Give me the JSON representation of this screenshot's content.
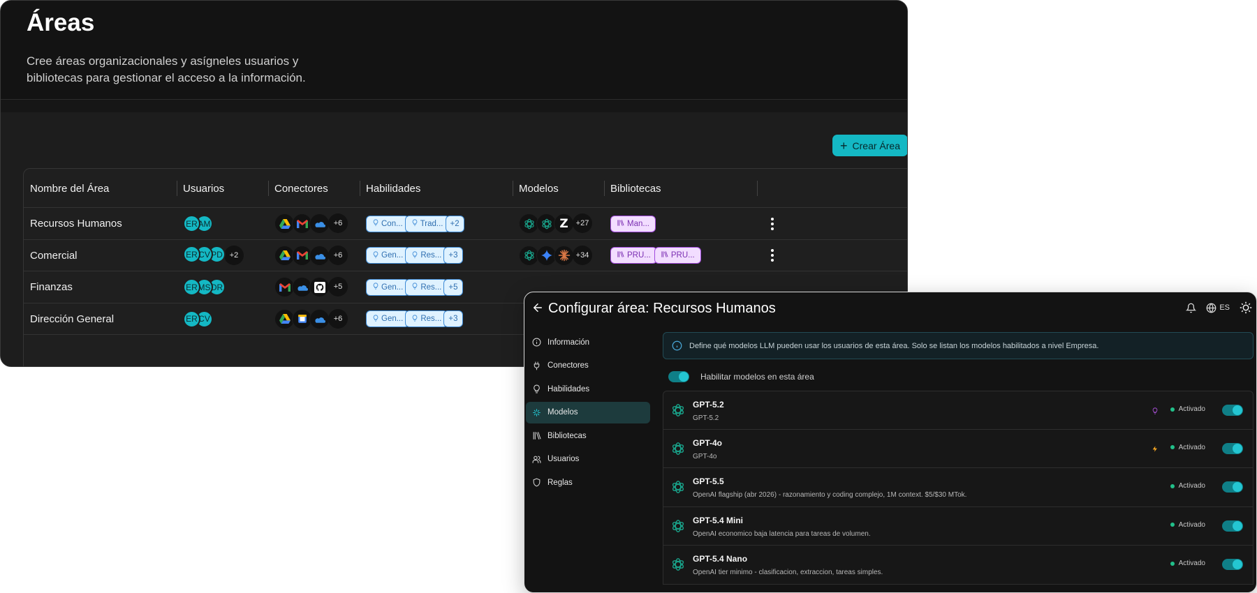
{
  "areas": {
    "title": "Áreas",
    "subtitle": "Cree áreas organizacionales y asígneles usuarios y bibliotecas para gestionar el acceso a la información.",
    "create_button": "Crear Área",
    "columns": [
      "Nombre del Área",
      "Usuarios",
      "Conectores",
      "Habilidades",
      "Modelos",
      "Bibliotecas"
    ],
    "rows": [
      {
        "name": "Recursos Humanos",
        "users": [
          "ER",
          "AM"
        ],
        "users_more": "",
        "connectors": [
          "google-drive",
          "gmail",
          "onedrive"
        ],
        "connectors_more": "+6",
        "skills": [
          "Con...",
          "Trad..."
        ],
        "skills_more": "+2",
        "models": [
          "openai",
          "openai",
          "zapier"
        ],
        "models_more": "+27",
        "libraries": [
          "Man..."
        ]
      },
      {
        "name": "Comercial",
        "users": [
          "ER",
          "CV",
          "PD"
        ],
        "users_more": "+2",
        "connectors": [
          "google-drive",
          "gmail",
          "onedrive"
        ],
        "connectors_more": "+6",
        "skills": [
          "Gen...",
          "Res..."
        ],
        "skills_more": "+3",
        "models": [
          "openai",
          "gemini",
          "claude"
        ],
        "models_more": "+34",
        "libraries": [
          "PRU...",
          "PRU..."
        ]
      },
      {
        "name": "Finanzas",
        "users": [
          "ER",
          "MS",
          "DR"
        ],
        "users_more": "",
        "connectors": [
          "gmail",
          "onedrive",
          "github"
        ],
        "connectors_more": "+5",
        "skills": [
          "Gen...",
          "Res..."
        ],
        "skills_more": "+5",
        "models": [],
        "models_more": "",
        "libraries": []
      },
      {
        "name": "Dirección General",
        "users": [
          "ER",
          "CV"
        ],
        "users_more": "",
        "connectors": [
          "google-drive",
          "google-calendar",
          "onedrive"
        ],
        "connectors_more": "+6",
        "skills": [
          "Gen...",
          "Res..."
        ],
        "skills_more": "+3",
        "models": [],
        "models_more": "",
        "libraries": []
      }
    ]
  },
  "config": {
    "title": "Configurar área: Recursos Humanos",
    "language": "ES",
    "sidebar": [
      {
        "label": "Información",
        "icon": "info-icon",
        "active": false
      },
      {
        "label": "Conectores",
        "icon": "plug-icon",
        "active": false
      },
      {
        "label": "Habilidades",
        "icon": "lightbulb-icon",
        "active": false
      },
      {
        "label": "Modelos",
        "icon": "sparkle-icon",
        "active": true
      },
      {
        "label": "Bibliotecas",
        "icon": "books-icon",
        "active": false
      },
      {
        "label": "Usuarios",
        "icon": "users-icon",
        "active": false
      },
      {
        "label": "Reglas",
        "icon": "shield-icon",
        "active": false
      }
    ],
    "info_text": "Define qué modelos LLM pueden usar los usuarios de esta área. Solo se listan los modelos habilitados a nivel Empresa.",
    "enable_label": "Habilitar modelos en esta área",
    "enable_on": true,
    "models": [
      {
        "name": "GPT-5.2",
        "desc": "GPT-5.2",
        "badge": "bulb",
        "status": "Activado",
        "enabled": true
      },
      {
        "name": "GPT-4o",
        "desc": "GPT-4o",
        "badge": "bolt",
        "status": "Activado",
        "enabled": true
      },
      {
        "name": "GPT-5.5",
        "desc": "OpenAI flagship (abr 2026) - razonamiento y coding complejo, 1M context. $5/$30 MTok.",
        "badge": "",
        "status": "Activado",
        "enabled": true
      },
      {
        "name": "GPT-5.4 Mini",
        "desc": "OpenAI economico baja latencia para tareas de volumen.",
        "badge": "",
        "status": "Activado",
        "enabled": true
      },
      {
        "name": "GPT-5.4 Nano",
        "desc": "OpenAI tier minimo - clasificacion, extraccion, tareas simples.",
        "badge": "",
        "status": "Activado",
        "enabled": true
      }
    ]
  },
  "colors": {
    "accent": "#14b8c4",
    "skill_chip_border": "#3d8ad6",
    "library_chip_border": "#a249de",
    "status_on": "#22c08a"
  }
}
